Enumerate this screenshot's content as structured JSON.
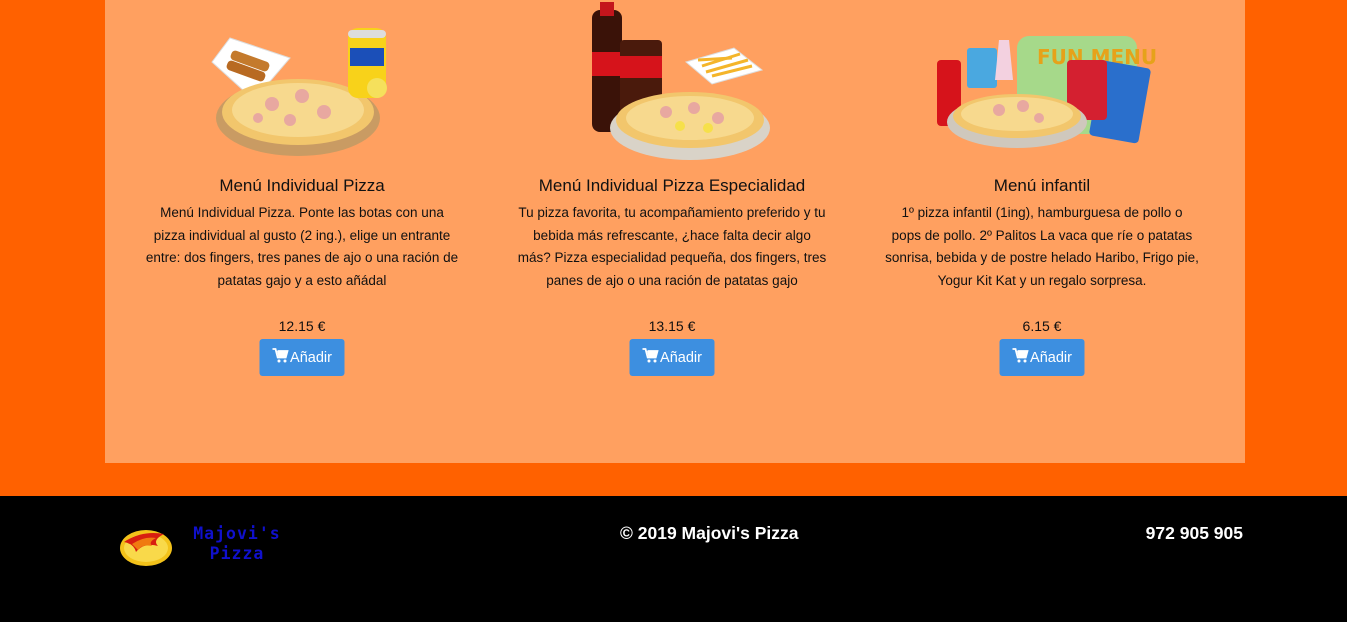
{
  "menu_items": [
    {
      "title": "Menú Individual Pizza",
      "description": "Menú Individual Pizza. Ponte las botas con una pizza individual al gusto (2 ing.), elige un entrante entre: dos fingers, tres panes de ajo o una ración de patatas gajo y a esto añádal",
      "price": "12.15 €",
      "button_label": "Añadir",
      "image": "pizza-with-fanta-and-fingers-image"
    },
    {
      "title": "Menú Individual Pizza Especialidad",
      "description": "Tu pizza favorita, tu acompañamiento preferido y tu bebida más refrescante, ¿hace falta decir algo más? Pizza especialidad pequeña, dos fingers, tres panes de ajo o una ración de patatas gajo",
      "price": "13.15 €",
      "button_label": "Añadir",
      "image": "pizza-with-coca-cola-and-fries-image"
    },
    {
      "title": "Menú infantil",
      "description": "1º pizza infantil (1ing), hamburguesa de pollo o pops de pollo. 2º Palitos La vaca que ríe o patatas sonrisa, bebida y de postre helado Haribo, Frigo pie, Yogur Kit Kat y un regalo sorpresa.",
      "price": "6.15 €",
      "button_label": "Añadir",
      "image": "fun-menu-kids-image"
    }
  ],
  "footer": {
    "logo_line1": "Majovi's",
    "logo_line2": "Pizza",
    "copyright": "© 2019 Majovi's Pizza",
    "phone": "972 905 905"
  },
  "colors": {
    "page_background": "#ff6100",
    "panel_background": "#ffa060",
    "button": "#3d8fe0",
    "footer_background": "#000000"
  },
  "icons": {
    "cart": "shopping-cart-icon"
  }
}
